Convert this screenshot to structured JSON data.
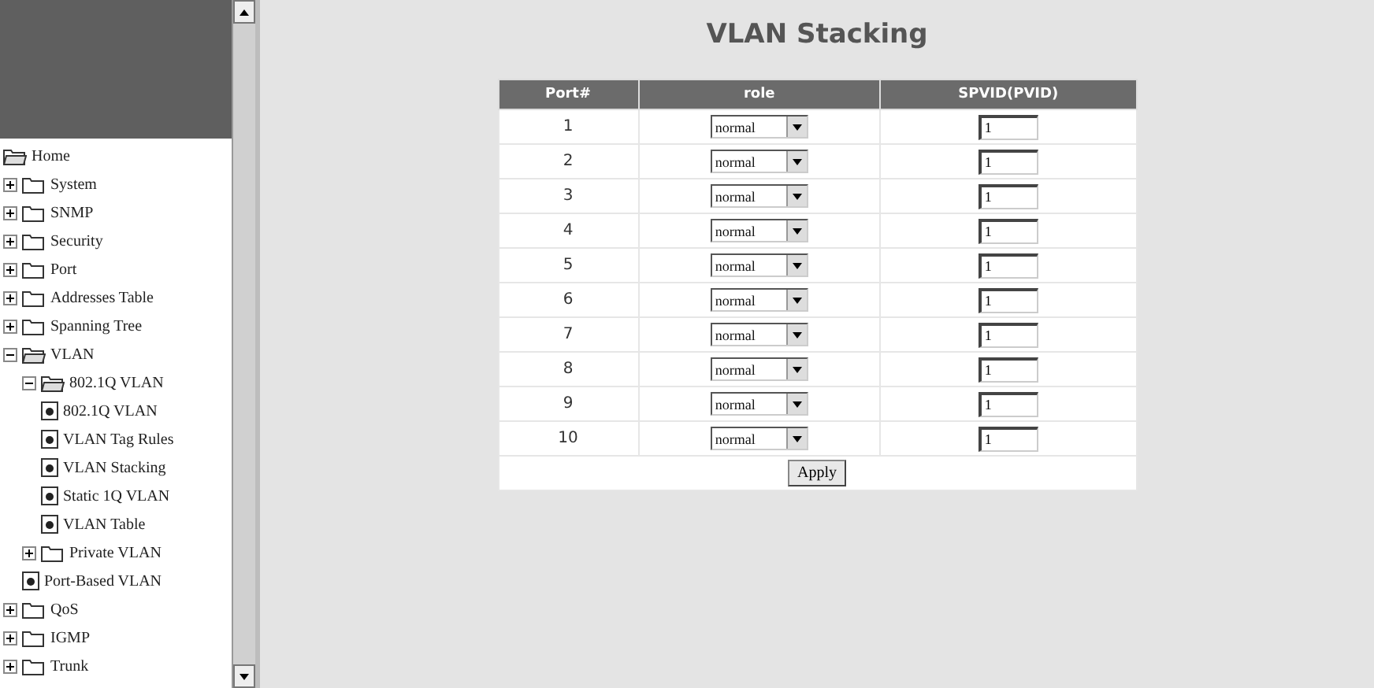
{
  "sidebar": {
    "tree": [
      {
        "label": "Home",
        "kind": "folder",
        "expanded": true
      },
      {
        "label": "System",
        "kind": "folder",
        "expanded": false
      },
      {
        "label": "SNMP",
        "kind": "folder",
        "expanded": false
      },
      {
        "label": "Security",
        "kind": "folder",
        "expanded": false
      },
      {
        "label": "Port",
        "kind": "folder",
        "expanded": false
      },
      {
        "label": "Addresses Table",
        "kind": "folder",
        "expanded": false
      },
      {
        "label": "Spanning Tree",
        "kind": "folder",
        "expanded": false
      },
      {
        "label": "VLAN",
        "kind": "folder",
        "expanded": true,
        "children": [
          {
            "label": "802.1Q VLAN",
            "kind": "folder",
            "expanded": true,
            "children": [
              {
                "label": "802.1Q VLAN",
                "kind": "page"
              },
              {
                "label": "VLAN Tag Rules",
                "kind": "page"
              },
              {
                "label": "VLAN Stacking",
                "kind": "page"
              },
              {
                "label": "Static 1Q VLAN",
                "kind": "page"
              },
              {
                "label": "VLAN Table",
                "kind": "page"
              }
            ]
          },
          {
            "label": "Private VLAN",
            "kind": "folder",
            "expanded": false
          },
          {
            "label": "Port-Based VLAN",
            "kind": "page"
          }
        ]
      },
      {
        "label": "QoS",
        "kind": "folder",
        "expanded": false
      },
      {
        "label": "IGMP",
        "kind": "folder",
        "expanded": false
      },
      {
        "label": "Trunk",
        "kind": "folder",
        "expanded": false
      }
    ]
  },
  "page": {
    "title": "VLAN Stacking"
  },
  "table": {
    "columns": [
      "Port#",
      "role",
      "SPVID(PVID)"
    ],
    "rows": [
      {
        "port": "1",
        "role": "normal",
        "spvid": "1"
      },
      {
        "port": "2",
        "role": "normal",
        "spvid": "1"
      },
      {
        "port": "3",
        "role": "normal",
        "spvid": "1"
      },
      {
        "port": "4",
        "role": "normal",
        "spvid": "1"
      },
      {
        "port": "5",
        "role": "normal",
        "spvid": "1"
      },
      {
        "port": "6",
        "role": "normal",
        "spvid": "1"
      },
      {
        "port": "7",
        "role": "normal",
        "spvid": "1"
      },
      {
        "port": "8",
        "role": "normal",
        "spvid": "1"
      },
      {
        "port": "9",
        "role": "normal",
        "spvid": "1"
      },
      {
        "port": "10",
        "role": "normal",
        "spvid": "1"
      }
    ]
  },
  "apply_button": "Apply"
}
